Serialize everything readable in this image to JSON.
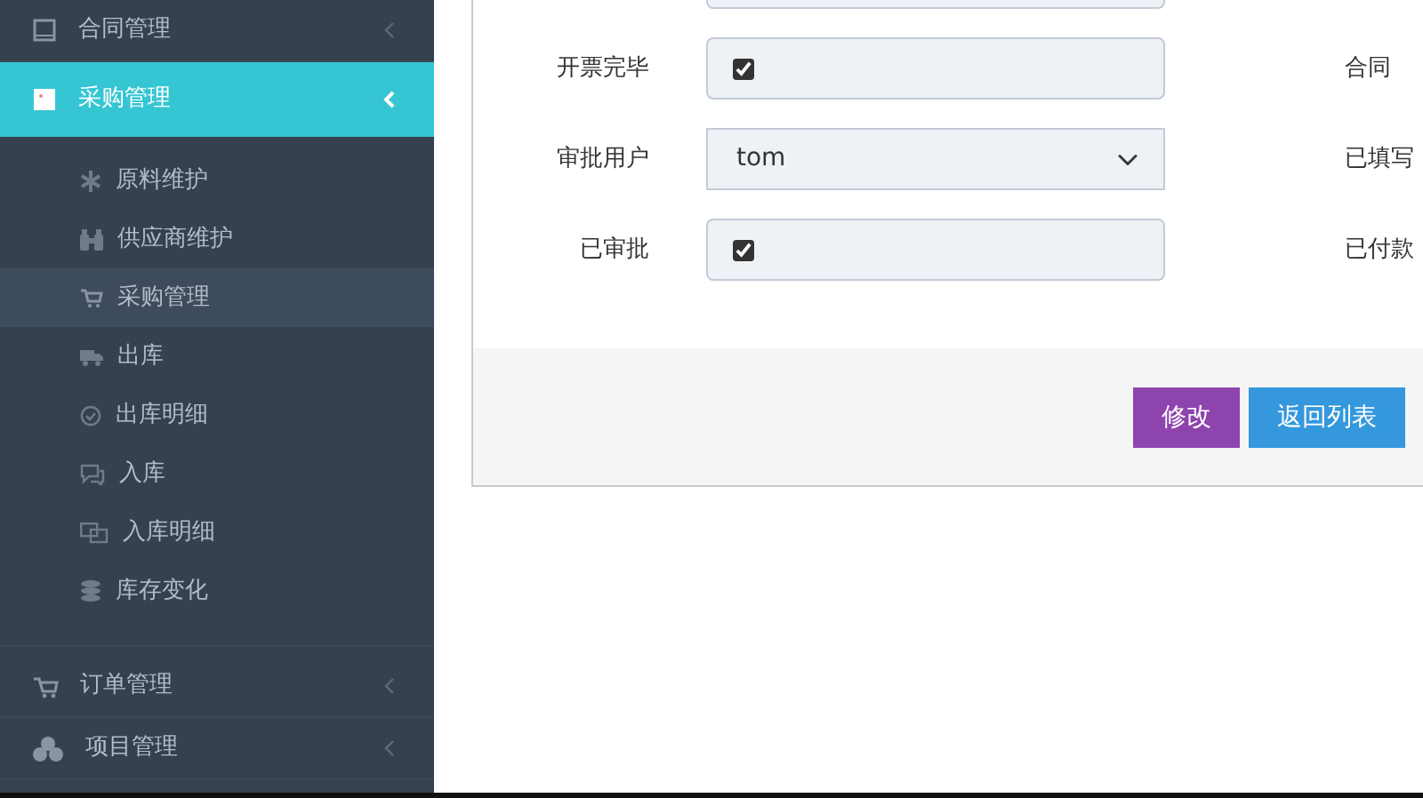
{
  "sidebar": {
    "items": [
      {
        "label": "合同管理",
        "selected": false,
        "expanded": false,
        "has_children": true
      },
      {
        "label": "采购管理",
        "selected": true,
        "expanded": true,
        "has_children": true,
        "children": [
          {
            "label": "原料维护",
            "selected": false
          },
          {
            "label": "供应商维护",
            "selected": false
          },
          {
            "label": "采购管理",
            "selected": true
          },
          {
            "label": "出库",
            "selected": false
          },
          {
            "label": "出库明细",
            "selected": false
          },
          {
            "label": "入库",
            "selected": false
          },
          {
            "label": "入库明细",
            "selected": false
          },
          {
            "label": "库存变化",
            "selected": false
          }
        ]
      },
      {
        "label": "订单管理",
        "selected": false,
        "expanded": false,
        "has_children": true
      },
      {
        "label": "项目管理",
        "selected": false,
        "expanded": false,
        "has_children": true
      }
    ]
  },
  "form": {
    "rows": [
      {
        "label": "开票完毕",
        "kind": "checkbox",
        "checked": true,
        "right_label": "合同"
      },
      {
        "label": "审批用户",
        "kind": "select",
        "value": "tom",
        "right_label": "已填写"
      },
      {
        "label": "已审批",
        "kind": "checkbox",
        "checked": true,
        "right_label": "已付款"
      }
    ],
    "buttons": [
      {
        "label": "修改",
        "kind": "edit"
      },
      {
        "label": "返回列表",
        "kind": "back"
      }
    ]
  }
}
